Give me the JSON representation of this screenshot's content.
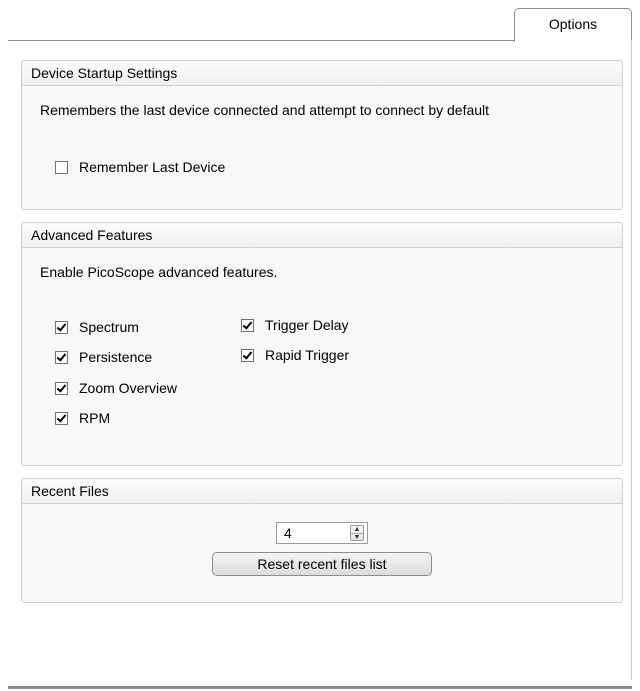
{
  "tab": {
    "label": "Options"
  },
  "device_startup": {
    "title": "Device Startup Settings",
    "description": "Remembers the last device connected and attempt to connect by default",
    "remember_last_device": {
      "label": "Remember Last Device",
      "checked": false
    }
  },
  "advanced_features": {
    "title": "Advanced Features",
    "description": "Enable PicoScope advanced features.",
    "items": [
      {
        "label": "Spectrum",
        "checked": true
      },
      {
        "label": "Persistence",
        "checked": true
      },
      {
        "label": "Zoom Overview",
        "checked": true
      },
      {
        "label": "RPM",
        "checked": true
      },
      {
        "label": "Trigger Delay",
        "checked": true
      },
      {
        "label": "Rapid Trigger",
        "checked": true
      }
    ]
  },
  "recent_files": {
    "title": "Recent Files",
    "count_value": "4",
    "reset_button_label": "Reset recent files list"
  }
}
